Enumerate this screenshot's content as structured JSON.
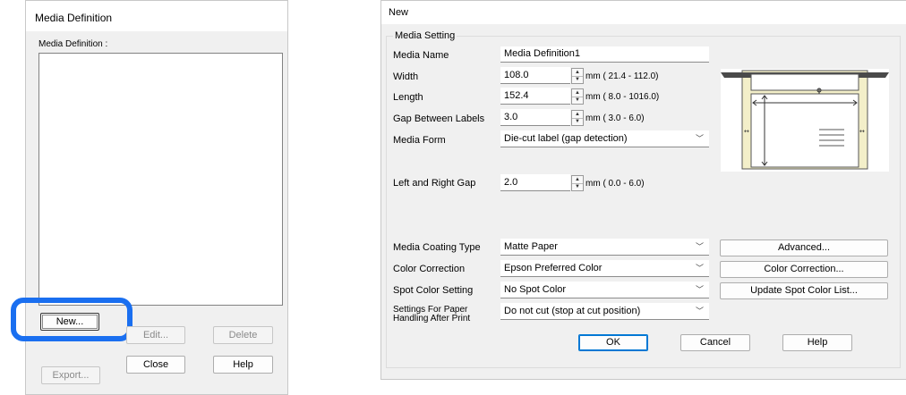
{
  "left_dialog": {
    "title": "Media Definition",
    "list_label": "Media Definition :",
    "buttons": {
      "new": "New...",
      "edit": "Edit...",
      "delete": "Delete",
      "export": "Export...",
      "close": "Close",
      "help": "Help"
    },
    "highlight_color": "#1a6ff0"
  },
  "right_dialog": {
    "title": "New",
    "group_title": "Media Setting",
    "media_name": {
      "label": "Media Name",
      "value": "Media Definition1"
    },
    "width": {
      "label": "Width",
      "value": "108.0",
      "range": "mm ( 21.4 - 112.0)"
    },
    "length": {
      "label": "Length",
      "value": "152.4",
      "range": "mm (  8.0 - 1016.0)"
    },
    "gap": {
      "label": "Gap Between Labels",
      "value": "3.0",
      "range": "mm (  3.0 -   6.0)"
    },
    "media_form": {
      "label": "Media Form",
      "value": "Die-cut label (gap detection)"
    },
    "lr_gap": {
      "label": "Left and Right Gap",
      "value": "2.0",
      "range": "mm (  0.0 -   6.0)"
    },
    "coating": {
      "label": "Media Coating Type",
      "value": "Matte Paper"
    },
    "color_correction": {
      "label": "Color Correction",
      "value": "Epson Preferred Color"
    },
    "spot_color": {
      "label": "Spot Color Setting",
      "value": "No Spot Color"
    },
    "after_print": {
      "label_line1": "Settings For Paper",
      "label_line2": "Handling After Print",
      "value": "Do not cut (stop at cut position)"
    },
    "side_buttons": {
      "advanced": "Advanced...",
      "color_correction": "Color Correction...",
      "update_spot": "Update Spot Color List..."
    },
    "footer": {
      "ok": "OK",
      "cancel": "Cancel",
      "help": "Help"
    },
    "icons": {
      "chevron": "chevron-down-icon",
      "spinner": "spinner-icon",
      "label_diagram": "label-diagram-icon"
    }
  }
}
